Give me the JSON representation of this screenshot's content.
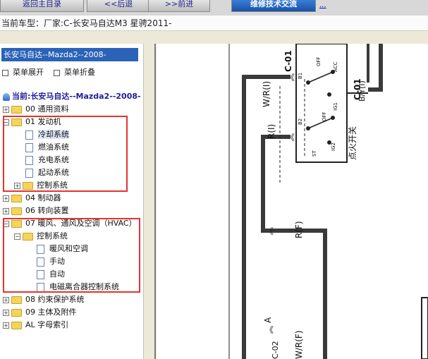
{
  "toolbar": {
    "buttons": [
      "返回主目录",
      "<<后退",
      ">>前进",
      "维修技术交流"
    ],
    "extra_link": "..."
  },
  "vehicle": {
    "label": "当前车型：厂家:C-长安马自达M3 星骋2011-"
  },
  "tree": {
    "header": "长安马自达--Mazda2--2008-",
    "expand_all": "菜单展开",
    "collapse_all": "菜单折叠",
    "current": "当前:长安马自达--Mazda2--2008-",
    "nodes": {
      "n00": "00 通用资料",
      "n01": "01 发动机",
      "cooling": "冷却系统",
      "fuel": "燃油系统",
      "charging": "充电系统",
      "starting": "起动系统",
      "control": "控制系统",
      "n04": "04 制动器",
      "n06": "06 转向装置",
      "n07": "07 暖风、通风及空调（HVAC）",
      "hvac_control": "控制系统",
      "hvac_ac": "暖风和空调",
      "manual": "手动",
      "auto": "自动",
      "clutch": "电磁离合器控制系统",
      "n08": "08 约束保护系统",
      "n09": "09 主体及附件",
      "al": "AL 字母索引"
    }
  },
  "diagram": {
    "wr_i": "W/R(I)",
    "c01_top": "C-01",
    "c01_right": "C-01",
    "by_i": "B/Y(I)",
    "r_i": "R(I)",
    "ignition_switch": "点火开关",
    "r_f": "R(F)",
    "a": "A",
    "wr_f": "W/R(F)",
    "c02": "C-02",
    "contacts": [
      "OFF",
      "ACC",
      "B1",
      "IG1",
      "B2",
      "OFF",
      "ST",
      "IG2"
    ]
  },
  "colors": {
    "highlight_box": "#e53232",
    "header_blue": "#2a63b7"
  }
}
